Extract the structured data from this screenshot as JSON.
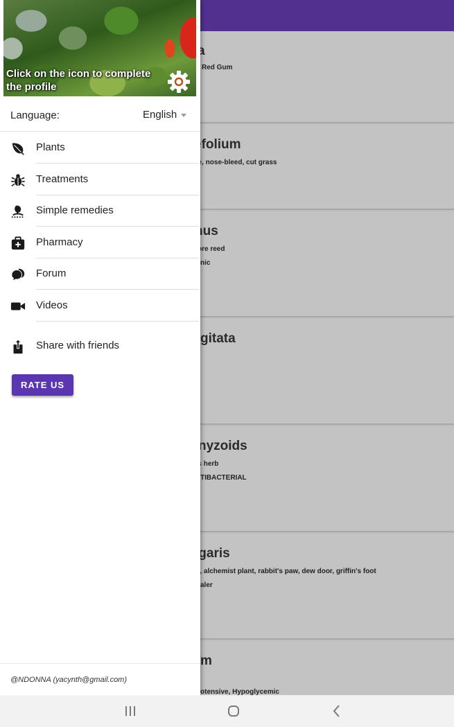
{
  "background_list": [
    {
      "title": "a",
      "lines": [
        "Red Gum"
      ]
    },
    {
      "title": "efolium",
      "lines": [
        "lle, nose-bleed, cut grass"
      ]
    },
    {
      "title": "nus",
      "lines": [
        "ore reed",
        "nic"
      ]
    },
    {
      "title": "gitata",
      "lines": []
    },
    {
      "title": "nyzoids",
      "lines": [
        "'s herb",
        "TIBACTERIAL"
      ]
    },
    {
      "title": "lgaris",
      "lines": [
        "t, alchemist plant, rabbit's paw, dew door, griffin's foot",
        "aler"
      ]
    },
    {
      "title": "m",
      "lines": [
        "",
        "otensive, Hypoglycemic"
      ]
    }
  ],
  "drawer": {
    "header_caption": "Click on the icon to complete the profile",
    "settings_icon": "gear-icon",
    "language_label": "Language:",
    "language_value": "English",
    "menu": [
      {
        "label": "Plants",
        "icon": "leaf-icon"
      },
      {
        "label": "Treatments",
        "icon": "bug-icon"
      },
      {
        "label": "Simple remedies",
        "icon": "remedy-icon"
      },
      {
        "label": "Pharmacy",
        "icon": "medical-kit-icon"
      },
      {
        "label": "Forum",
        "icon": "chat-bubbles-icon"
      },
      {
        "label": "Videos",
        "icon": "video-camera-icon"
      },
      {
        "label": "Share with friends",
        "icon": "share-icon"
      }
    ],
    "rate_button": "RATE US",
    "footer": "@NDONNA (yacynth@gmail.com)"
  },
  "colors": {
    "app_bar": "#52308f",
    "rate_button": "#5a36b0"
  },
  "navbar": {
    "recents_icon": "recents-icon",
    "home_icon": "home-icon",
    "back_icon": "back-icon"
  }
}
